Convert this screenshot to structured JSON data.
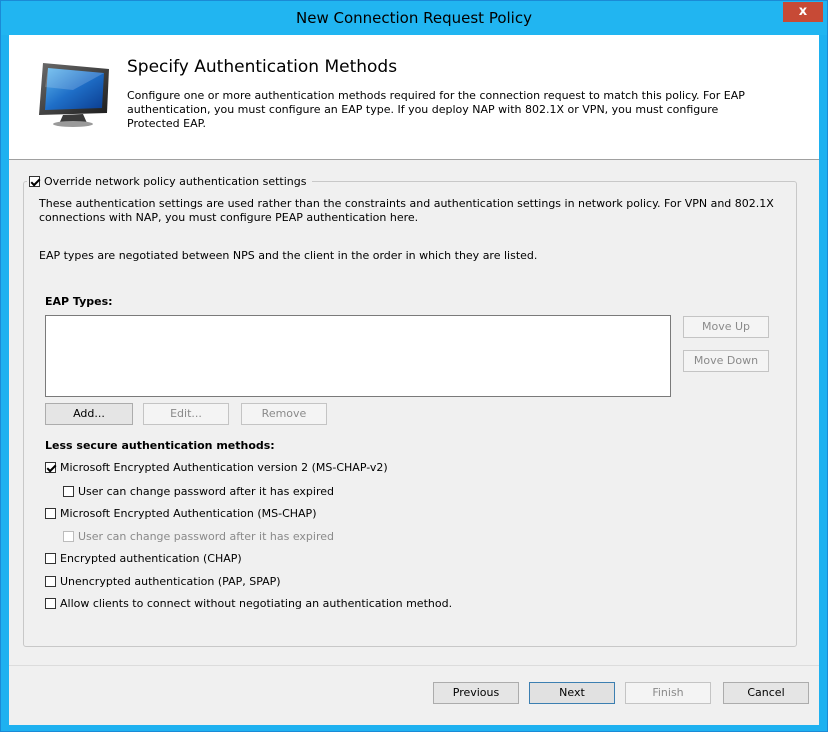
{
  "window": {
    "title": "New Connection Request Policy",
    "close_glyph": "x"
  },
  "header": {
    "title": "Specify Authentication Methods",
    "description": "Configure one or more authentication methods required for the connection request to match this policy. For EAP authentication, you must configure an EAP type. If you deploy NAP with 802.1X or VPN, you must configure Protected EAP.",
    "icon": "monitor-icon"
  },
  "override": {
    "label": "Override network policy authentication settings",
    "checked": true
  },
  "info": {
    "line1": "These authentication settings are used rather than the constraints and authentication settings in network policy. For VPN and 802.1X connections with NAP, you must configure PEAP authentication here.",
    "line2": "EAP types are negotiated between NPS and the client in the order in which they are listed."
  },
  "eap": {
    "heading": "EAP Types:",
    "items": [],
    "move_up": "Move Up",
    "move_down": "Move Down",
    "add": "Add...",
    "edit": "Edit...",
    "remove": "Remove"
  },
  "less_secure": {
    "heading": "Less secure authentication methods:",
    "options": [
      {
        "label": "Microsoft Encrypted Authentication version 2 (MS-CHAP-v2)",
        "checked": true,
        "enabled": true
      },
      {
        "label": "User can change password after it has expired",
        "checked": false,
        "enabled": true
      },
      {
        "label": "Microsoft Encrypted Authentication (MS-CHAP)",
        "checked": false,
        "enabled": true
      },
      {
        "label": "User can change password after it has expired",
        "checked": false,
        "enabled": false
      },
      {
        "label": "Encrypted authentication (CHAP)",
        "checked": false,
        "enabled": true
      },
      {
        "label": "Unencrypted authentication (PAP, SPAP)",
        "checked": false,
        "enabled": true
      },
      {
        "label": "Allow clients to connect without negotiating an authentication method.",
        "checked": false,
        "enabled": true
      }
    ]
  },
  "footer": {
    "previous": "Previous",
    "next": "Next",
    "finish": "Finish",
    "cancel": "Cancel"
  },
  "colors": {
    "titlebar": "#21b5f1",
    "close": "#c74a36",
    "panel": "#f0f0f0"
  }
}
